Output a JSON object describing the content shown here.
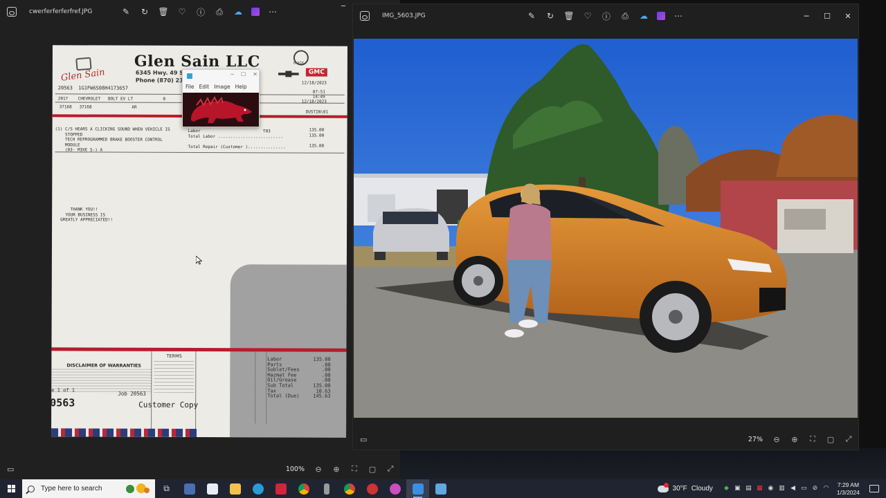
{
  "left_window": {
    "title": "cwerferferferfref.JPG",
    "zoom": "100%"
  },
  "right_window": {
    "title": "IMG_5603.JPG",
    "zoom": "27%"
  },
  "receipt": {
    "company": "Glen Sain LLC",
    "logo_script": "Glen Sain",
    "address": "6345 Hwy. 49 Sou",
    "phone": "Phone (870) 236-",
    "brand_buick": "BUICK",
    "brand_gmc": "GMC",
    "ro_line": "20563  1G1FW6S08H4173657",
    "date1": "12/18/2023",
    "time1": "07:51",
    "time2": "14:49",
    "date2": "12/18/2023",
    "vehicle_line": "2017    CHEVROLET   BOLT EV LT            0",
    "mileage_line": "37168   37168                AR",
    "advisor": "DUSTIN\\01",
    "concern": "(1) C/S HEARS A CLICKING SOUND WHEN VEHICLE IS\n    STOPPED\n    TECH REPROGRAMMED BRAKE BOOSTER CONTROL\n    MODULE\n    (03- MIKE S-) A",
    "labor_col": "Labor                         T03\nTotal Labor ..........................\n\nTotal Repair (Customer )...............",
    "labor_amts": "135.00\n135.00\n\n135.00",
    "thanks": "    THANK YOU!!\n  YOUR BUSINESS IS\nGREATLY APPRECIATED!!",
    "disclaimer_title": "DISCLAIMER OF WARRANTIES",
    "terms_title": "TERMS",
    "totals_labels": "Labor\nParts\nSublet/Fees\nHazmat Fee\nOil/Grease\nSub Total\nTax\nTotal (Due)",
    "totals_values": "135.00\n.00\n.00\n.00\n.00\n135.00\n10.63\n145.63",
    "page": "e 1 of 1",
    "job": "Job 20563",
    "ro_big": "0563",
    "copy": "Customer Copy"
  },
  "mini_paint": {
    "menu": [
      "File",
      "Edit",
      "Image",
      "Help"
    ]
  },
  "taskbar": {
    "search_placeholder": "Type here to search",
    "weather_temp": "30°F",
    "weather_cond": "Cloudy",
    "time": "7:29 AM",
    "date": "1/3/2024"
  },
  "colors": {
    "receipt_red": "#b71c2a",
    "gmc_red": "#c4262e",
    "car_orange": "#d9831f",
    "sky": "#2d6fd8",
    "taskbar": "#1f2430"
  },
  "icons": {
    "toolbar": [
      "edit-icon",
      "rotate-icon",
      "delete-icon",
      "favorite-icon",
      "info-icon",
      "print-icon",
      "onedrive-icon",
      "clipchamp-icon",
      "more-icon"
    ]
  }
}
